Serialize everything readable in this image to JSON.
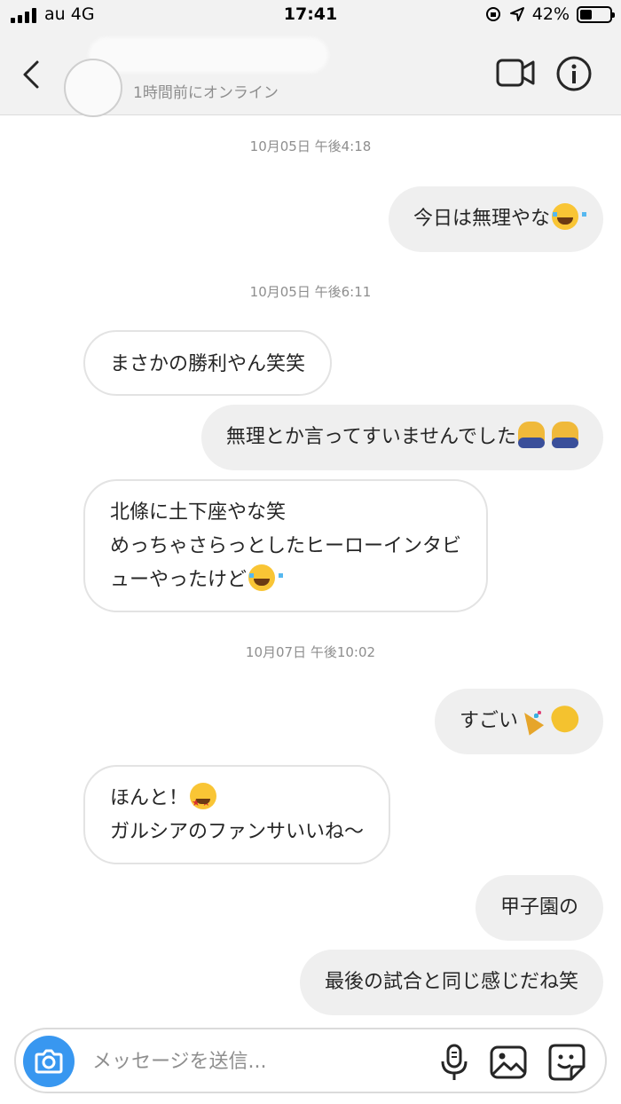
{
  "status_bar": {
    "carrier": "au 4G",
    "time": "17:41",
    "battery": "42%",
    "battery_level": 0.42
  },
  "header": {
    "status": "1時間前にオンライン"
  },
  "messages": [
    {
      "type": "timestamp",
      "text": "10月05日 午後4:18"
    },
    {
      "type": "out",
      "text": "今日は無理やな"
    },
    {
      "type": "timestamp",
      "text": "10月05日 午後6:11"
    },
    {
      "type": "in",
      "text": "まさかの勝利やん笑笑"
    },
    {
      "type": "out",
      "text": "無理とか言ってすいませんでした"
    },
    {
      "type": "in",
      "lines": [
        "北條に土下座やな笑",
        "めっちゃさらっとしたヒーローインタビ",
        "ューやったけど"
      ]
    },
    {
      "type": "timestamp",
      "text": "10月07日 午後10:02"
    },
    {
      "type": "out",
      "text": "すごい"
    },
    {
      "type": "in",
      "lines": [
        "ほんと！",
        "ガルシアのファンサいいね〜"
      ]
    },
    {
      "type": "out",
      "text": "甲子園の"
    },
    {
      "type": "out",
      "text": "最後の試合と同じ感じだね笑"
    }
  ],
  "composer": {
    "placeholder": "メッセージを送信..."
  },
  "icons": {
    "back": "chevron-left-icon",
    "video": "video-camera-icon",
    "info": "info-icon",
    "camera": "camera-icon",
    "mic": "microphone-icon",
    "gallery": "image-icon",
    "sticker": "sticker-icon"
  },
  "colors": {
    "accent": "#3897f0",
    "outgoing_bubble": "#efefef",
    "incoming_border": "#e3e3e3",
    "secondary_text": "#8e8e8e"
  }
}
